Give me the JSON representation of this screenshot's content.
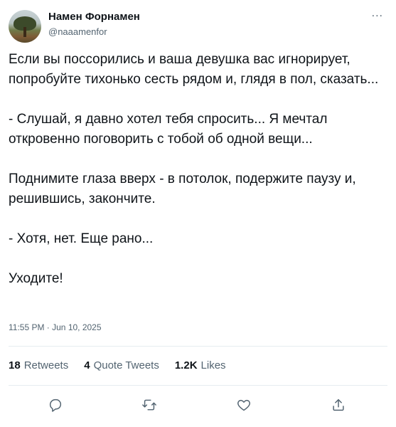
{
  "author": {
    "name": "Намен Форнамен",
    "handle": "@naaamenfor"
  },
  "more_label": "...",
  "tweet": {
    "paragraphs": [
      "Если вы поссорились и ваша девушка вас игнорирует, попробуйте тихонько сесть рядом и, глядя в пол, сказать...",
      "- Слушай, я давно хотел тебя спросить... Я мечтал откровенно поговорить с тобой об одной вещи...",
      "Поднимите глаза вверх - в потолок, подержите паузу и, решившись, закончите.",
      "- Хотя, нет. Еще рано...",
      "Уходите!"
    ],
    "timestamp": "11:55 PM · Jun 10, 2025"
  },
  "stats": {
    "retweets_count": "18",
    "retweets_label": "Retweets",
    "quotes_count": "4",
    "quotes_label": "Quote Tweets",
    "likes_count": "1.2K",
    "likes_label": "Likes"
  },
  "actions": {
    "reply_icon": "reply-icon",
    "retweet_icon": "retweet-icon",
    "like_icon": "heart-icon",
    "share_icon": "share-icon"
  },
  "colors": {
    "text": "#0f1419",
    "secondary": "#536471",
    "divider": "#e6ecf0"
  }
}
